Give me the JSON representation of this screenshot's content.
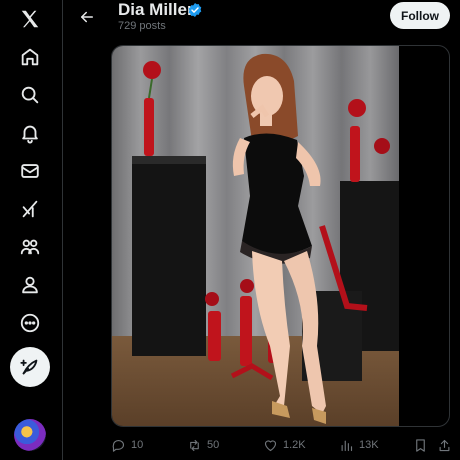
{
  "sidebar": {
    "items": [
      {
        "icon": "x-logo-icon"
      },
      {
        "icon": "home-icon"
      },
      {
        "icon": "search-icon"
      },
      {
        "icon": "notifications-bell-icon"
      },
      {
        "icon": "messages-envelope-icon"
      },
      {
        "icon": "grok-icon"
      },
      {
        "icon": "communities-icon"
      },
      {
        "icon": "profile-icon"
      },
      {
        "icon": "more-icon"
      }
    ],
    "compose_icon": "feather-compose-icon"
  },
  "header": {
    "name": "Dia Miller",
    "posts": "729 posts",
    "follow_label": "Follow"
  },
  "colors": {
    "background": "#000000",
    "text": "#e7e9ea",
    "muted": "#71767b",
    "verified": "#1d9bf0",
    "follow_bg": "#eff3f4"
  },
  "actions": {
    "replies": "10",
    "reposts": "50",
    "likes": "1.2K",
    "views": "13K"
  }
}
